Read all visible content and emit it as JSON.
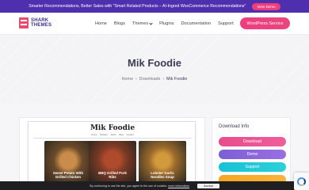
{
  "promo": {
    "text": "Smarter Recommendations, Better Sales with \"Smart Related Products – AI-Ingred WooCommerce Recommendations\"",
    "button": "View Demo"
  },
  "header": {
    "logo_line1": "SHARK",
    "logo_line2": "THEMES",
    "nav": [
      {
        "label": "Home"
      },
      {
        "label": "Blogs"
      },
      {
        "label": "Themes"
      },
      {
        "label": "Plugins"
      },
      {
        "label": "Documentation"
      },
      {
        "label": "Support"
      }
    ],
    "cta": "WordPress Service"
  },
  "hero": {
    "title": "Mik Foodie",
    "breadcrumb": [
      "Home",
      "Downloads",
      "Mik Foodie"
    ]
  },
  "preview": {
    "site_title": "Mik Foodie",
    "nav": [
      "Home",
      "Recipes",
      "About",
      "Blog",
      "Contact"
    ],
    "cards": [
      {
        "caption_line1": "Sweet Potato With",
        "caption_line2": "Grilled Chicken"
      },
      {
        "caption_line1": "BBQ Grilled Pork",
        "caption_line2": "Ribs"
      },
      {
        "caption_line1": "Lobster Garlic",
        "caption_line2": "Noodles Soup"
      }
    ]
  },
  "sidebar": {
    "title": "Download Info",
    "buttons": [
      {
        "label": "Download",
        "color": "#e84d8a"
      },
      {
        "label": "Demo",
        "color": "#7b5fd4"
      },
      {
        "label": "Support",
        "color": "#18c1d6"
      },
      {
        "label": "",
        "color": "#f6a623"
      }
    ]
  },
  "cookie": {
    "text": "By continuing to use the site, you agree to the use of cookies.",
    "link": "more information",
    "button": "Accept"
  },
  "colors": {
    "promo_bg": "#4e2fae",
    "accent_pink": "#ef3d7c",
    "title": "#3c3a56"
  }
}
